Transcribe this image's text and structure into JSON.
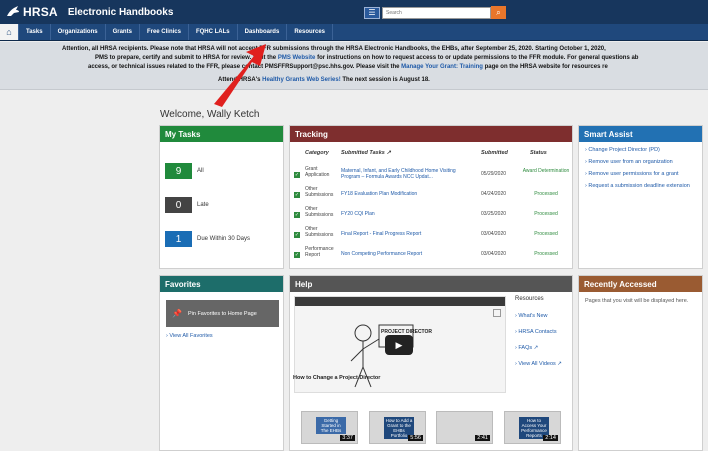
{
  "header": {
    "logo_text": "HRSA",
    "app_title": "Electronic Handbooks",
    "search_placeholder": "Search"
  },
  "nav": {
    "items": [
      "Tasks",
      "Organizations",
      "Grants",
      "Free Clinics",
      "FQHC LALs",
      "Dashboards",
      "Resources"
    ]
  },
  "announcement": {
    "line1": "Attention, all HRSA recipients. Please note that HRSA will not accept FFR submissions through the HRSA Electronic Handbooks, the EHBs, after September 25, 2020. Starting October 1, 2020,",
    "line2_pre": "PMS to prepare, certify and submit to HRSA for review. Visit the",
    "line2_link": "PMS Website",
    "line2_post": "for instructions on how to request access to or update permissions to the FFR module. For general questions ab",
    "line3_pre": "access, or technical issues related to the FFR, please contact PMSFFRSupport@psc.hhs.gov. Please visit the",
    "line3_link": "Manage Your Grant: Training",
    "line3_post": "page on the HRSA website for resources re",
    "line4_pre": "Attend HRSA's",
    "line4_link": "Healthy Grants Web Series!",
    "line4_post": "The next session is August 18."
  },
  "welcome": "Welcome, Wally Ketch",
  "my_tasks": {
    "title": "My Tasks",
    "rows": [
      {
        "count": "9",
        "label": "All",
        "color": "#208a3c"
      },
      {
        "count": "0",
        "label": "Late",
        "color": "#444444"
      },
      {
        "count": "1",
        "label": "Due Within 30 Days",
        "color": "#1a6db5"
      }
    ]
  },
  "tracking": {
    "title": "Tracking",
    "headers": {
      "category": "Category",
      "task": "Submitted Tasks ↗",
      "submitted": "Submitted",
      "status": "Status"
    },
    "rows": [
      {
        "category": "Grant Application",
        "task": "Maternal, Infant, and Early Childhood Home Visiting Program – Formula Awards NCC Updat...",
        "date": "05/29/2020",
        "status": "Award Determination"
      },
      {
        "category": "Other Submissions",
        "task": "FY18 Evaluation Plan Modification",
        "date": "04/24/2020",
        "status": "Processed"
      },
      {
        "category": "Other Submissions",
        "task": "FY20 CQI Plan",
        "date": "03/25/2020",
        "status": "Processed"
      },
      {
        "category": "Other Submissions",
        "task": "Final Report - Final Progress Report",
        "date": "03/04/2020",
        "status": "Processed"
      },
      {
        "category": "Performance Report",
        "task": "Non Competing Performance Report",
        "date": "03/04/2020",
        "status": "Processed"
      }
    ]
  },
  "smart_assist": {
    "title": "Smart Assist",
    "items": [
      "› Change Project Director (PD)",
      "› Remove user from an organization",
      "› Remove user permissions for a grant",
      "› Request a submission deadline extension"
    ]
  },
  "favorites": {
    "title": "Favorites",
    "pin_label": "Pin Favorites to Home Page",
    "view_all": "› View All Favorites"
  },
  "help": {
    "title": "Help",
    "video_caption": "How to Change a Project Director",
    "video_sign": "PROJECT DIRECTOR",
    "resources_title": "Resources",
    "resources": [
      "› What's New",
      "› HRSA Contacts",
      "› FAQs ↗",
      "› View All Videos ↗"
    ],
    "thumbs": [
      {
        "title": "Getting Started in The EHBs",
        "duration": "3:37"
      },
      {
        "title": "How to Add a Grant to the EHBs Portfolio",
        "duration": "5:56"
      },
      {
        "title": "",
        "duration": "2:41"
      },
      {
        "title": "How to Access Your Performance Reports",
        "duration": "2:14"
      }
    ]
  },
  "recent": {
    "title": "Recently Accessed",
    "text": "Pages that you visit will be displayed here."
  }
}
